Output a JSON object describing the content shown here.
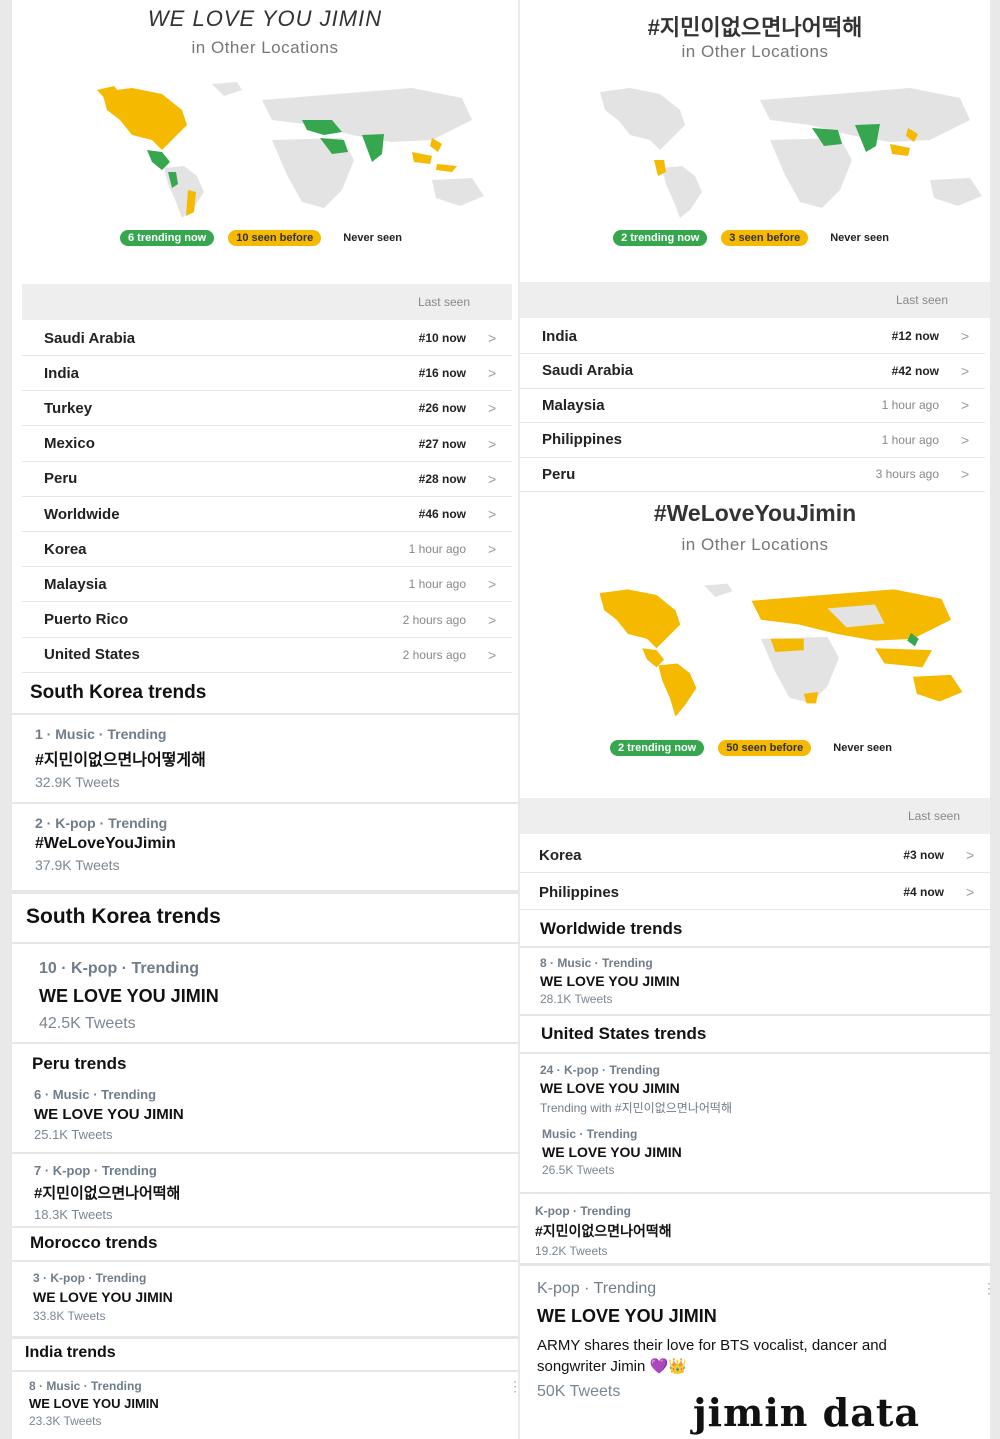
{
  "colors": {
    "trending": "#36a64f",
    "seen": "#f5b900",
    "never": "#e3e3e3"
  },
  "left": {
    "map": {
      "title": "WE LOVE YOU JIMIN",
      "subtitle": "in Other Locations",
      "legend": {
        "trending": "6 trending now",
        "seen": "10 seen before",
        "never": "Never seen"
      }
    },
    "table_header": "Last seen",
    "rows": [
      {
        "name": "Saudi Arabia",
        "when": "#10 now"
      },
      {
        "name": "India",
        "when": "#16 now"
      },
      {
        "name": "Turkey",
        "when": "#26 now"
      },
      {
        "name": "Mexico",
        "when": "#27 now"
      },
      {
        "name": "Peru",
        "when": "#28 now"
      },
      {
        "name": "Worldwide",
        "when": "#46 now"
      },
      {
        "name": "Korea",
        "when": "1 hour ago"
      },
      {
        "name": "Malaysia",
        "when": "1 hour ago"
      },
      {
        "name": "Puerto Rico",
        "when": "2 hours ago"
      },
      {
        "name": "United States",
        "when": "2 hours ago"
      }
    ],
    "sk_trends_1": {
      "title": "South Korea trends",
      "items": [
        {
          "meta": "1 · Music · Trending",
          "name": "#지민이없으면나어떻게해",
          "count": "32.9K Tweets"
        },
        {
          "meta": "2 · K-pop · Trending",
          "name": "#WeLoveYouJimin",
          "count": "37.9K Tweets"
        }
      ]
    },
    "sk_trends_2": {
      "title": "South Korea trends",
      "items": [
        {
          "meta": "10 · K-pop · Trending",
          "name": "WE LOVE YOU JIMIN",
          "count": "42.5K Tweets"
        }
      ]
    },
    "peru_trends": {
      "title": "Peru trends",
      "items": [
        {
          "meta": "6 · Music · Trending",
          "name": "WE LOVE YOU JIMIN",
          "count": "25.1K Tweets"
        },
        {
          "meta": "7 · K-pop · Trending",
          "name": "#지민이없으면나어떡해",
          "count": "18.3K Tweets"
        }
      ]
    },
    "morocco_trends": {
      "title": "Morocco trends",
      "items": [
        {
          "meta": "3 · K-pop · Trending",
          "name": "WE LOVE YOU JIMIN",
          "count": "33.8K Tweets"
        }
      ]
    },
    "india_trends": {
      "title": "India trends",
      "items": [
        {
          "meta": "8 · Music · Trending",
          "name": "WE LOVE YOU JIMIN",
          "count": "23.3K Tweets"
        }
      ]
    }
  },
  "right": {
    "map1": {
      "title": "#지민이없으면나어떡해",
      "subtitle": "in Other Locations",
      "legend": {
        "trending": "2 trending now",
        "seen": "3 seen before",
        "never": "Never seen"
      }
    },
    "table1_header": "Last seen",
    "rows1": [
      {
        "name": "India",
        "when": "#12 now"
      },
      {
        "name": "Saudi Arabia",
        "when": "#42 now"
      },
      {
        "name": "Malaysia",
        "when": "1 hour ago"
      },
      {
        "name": "Philippines",
        "when": "1 hour ago"
      },
      {
        "name": "Peru",
        "when": "3 hours ago"
      }
    ],
    "map2": {
      "title": "#WeLoveYouJimin",
      "subtitle": "in Other Locations",
      "legend": {
        "trending": "2 trending now",
        "seen": "50 seen before",
        "never": "Never seen"
      }
    },
    "table2_header": "Last seen",
    "rows2": [
      {
        "name": "Korea",
        "when": "#3 now"
      },
      {
        "name": "Philippines",
        "when": "#4 now"
      }
    ],
    "worldwide_trends": {
      "title": "Worldwide trends",
      "items": [
        {
          "meta": "8 · Music · Trending",
          "name": "WE LOVE YOU JIMIN",
          "count": "28.1K Tweets"
        }
      ]
    },
    "us_trends": {
      "title": "United States trends",
      "items": [
        {
          "meta": "24 · K-pop · Trending",
          "name": "WE LOVE YOU JIMIN",
          "extra": "Trending with #지민이없으면나어떡해"
        },
        {
          "meta": "Music · Trending",
          "name": "WE LOVE YOU JIMIN",
          "count": "26.5K Tweets"
        },
        {
          "meta": "K-pop · Trending",
          "name": "#지민이없으면나어떡해",
          "count": "19.2K Tweets"
        }
      ]
    },
    "featured": {
      "meta": "K-pop · Trending",
      "name": "WE LOVE YOU JIMIN",
      "desc": "ARMY shares their love for BTS vocalist, dancer and songwriter Jimin 💜👑",
      "count": "50K Tweets"
    }
  },
  "watermark": "jimin data"
}
